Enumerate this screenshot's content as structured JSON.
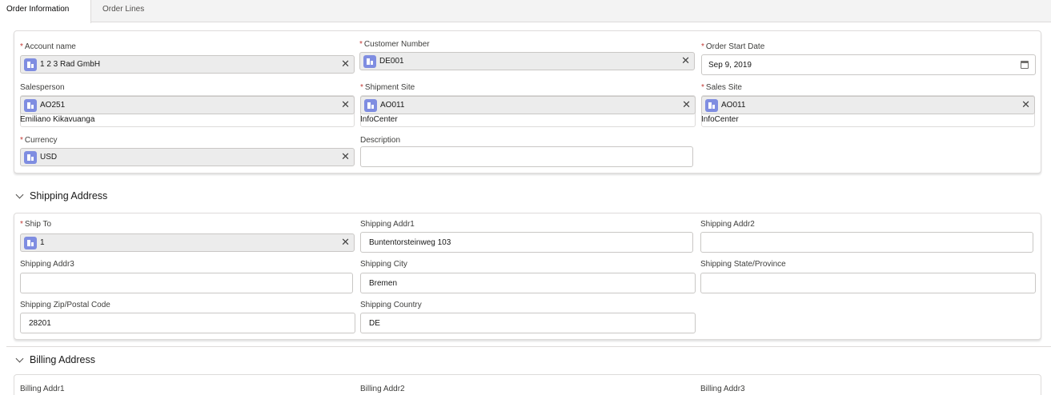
{
  "tabs": [
    {
      "label": "Order Information",
      "active": true
    },
    {
      "label": "Order Lines",
      "active": false
    }
  ],
  "order": {
    "account_name": {
      "label": "Account name",
      "value": "1 2 3 Rad GmbH",
      "required": true
    },
    "customer_number": {
      "label": "Customer Number",
      "value": "DE001",
      "required": true
    },
    "order_start_date": {
      "label": "Order Start Date",
      "value": "Sep 9, 2019",
      "required": true
    },
    "salesperson": {
      "label": "Salesperson",
      "value": "AO251",
      "sub": "Emiliano Kikavuanga"
    },
    "shipment_site": {
      "label": "Shipment Site",
      "value": "AO011",
      "sub": "InfoCenter",
      "required": true
    },
    "sales_site": {
      "label": "Sales Site",
      "value": "AO011",
      "sub": "InfoCenter",
      "required": true
    },
    "currency": {
      "label": "Currency",
      "value": "USD",
      "required": true
    },
    "description": {
      "label": "Description",
      "value": ""
    }
  },
  "shipping": {
    "title": "Shipping Address",
    "ship_to": {
      "label": "Ship To",
      "value": "1",
      "required": true
    },
    "addr1": {
      "label": "Shipping Addr1",
      "value": "Buntentorsteinweg 103"
    },
    "addr2": {
      "label": "Shipping Addr2",
      "value": ""
    },
    "addr3": {
      "label": "Shipping Addr3",
      "value": ""
    },
    "city": {
      "label": "Shipping City",
      "value": "Bremen"
    },
    "state": {
      "label": "Shipping State/Province",
      "value": ""
    },
    "zip": {
      "label": "Shipping Zip/Postal Code",
      "value": "28201"
    },
    "country": {
      "label": "Shipping Country",
      "value": "DE"
    }
  },
  "billing": {
    "title": "Billing Address",
    "addr1": {
      "label": "Billing Addr1"
    },
    "addr2": {
      "label": "Billing Addr2"
    },
    "addr3": {
      "label": "Billing Addr3"
    }
  },
  "icons": {
    "lookup": "building-icon",
    "clear": "close-icon",
    "date": "calendar-icon",
    "section": "chevron-down-icon"
  },
  "colors": {
    "required": "#c23934",
    "lookup_icon": "#7f8de1",
    "pill_bg": "#ececec"
  }
}
